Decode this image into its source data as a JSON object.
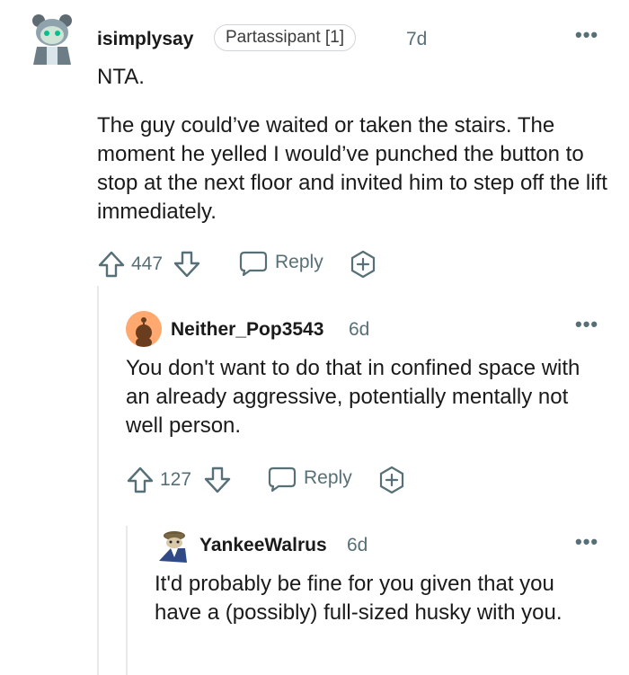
{
  "comments": [
    {
      "username": "isimplysay",
      "flair": "Partassipant [1]",
      "age": "7d",
      "paragraphs": [
        "NTA.",
        "The guy could’ve waited or taken the stairs. The moment he yelled I would’ve punched the button to stop at the next floor and invited him to step off the lift immediately."
      ],
      "score": "447",
      "reply_label": "Reply",
      "avatar_icon": "snoo-avatar-icon"
    },
    {
      "username": "Neither_Pop3543",
      "age": "6d",
      "paragraphs": [
        "You don't want to do that in confined space with an already aggressive, potentially mentally not well person."
      ],
      "score": "127",
      "reply_label": "Reply",
      "avatar_icon": "default-snoo-icon"
    },
    {
      "username": "YankeeWalrus",
      "age": "6d",
      "paragraphs": [
        "It'd probably be fine for you given that you have a (possibly) full-sized husky with you."
      ],
      "avatar_icon": "walrus-avatar-icon"
    }
  ],
  "more_icon": "more-options-icon"
}
